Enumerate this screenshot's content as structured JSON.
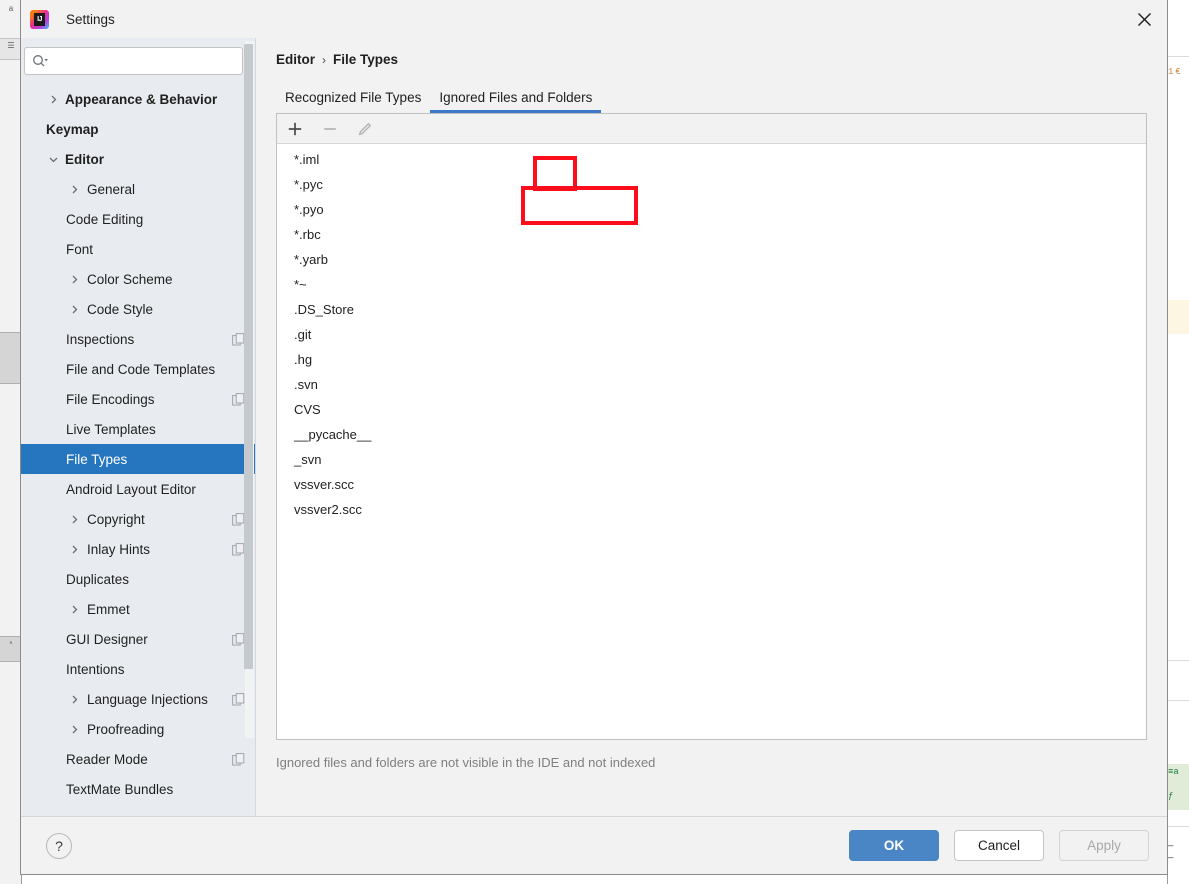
{
  "window": {
    "title": "Settings",
    "logo_icon": "intellij-idea-logo",
    "close_icon": "close-icon"
  },
  "search": {
    "value": "",
    "placeholder": "",
    "icon": "search-icon"
  },
  "sidebar": {
    "items": [
      {
        "label": "Appearance & Behavior",
        "level": 0,
        "arrow": "chevron-right-icon",
        "selected": false,
        "badge": false
      },
      {
        "label": "Keymap",
        "level": 0,
        "arrow": "",
        "selected": false,
        "badge": false
      },
      {
        "label": "Editor",
        "level": 0,
        "arrow": "chevron-down-icon",
        "selected": false,
        "badge": false
      },
      {
        "label": "General",
        "level": 1,
        "arrow": "chevron-right-icon",
        "selected": false,
        "badge": false
      },
      {
        "label": "Code Editing",
        "level": 1,
        "arrow": "",
        "selected": false,
        "badge": false
      },
      {
        "label": "Font",
        "level": 1,
        "arrow": "",
        "selected": false,
        "badge": false
      },
      {
        "label": "Color Scheme",
        "level": 1,
        "arrow": "chevron-right-icon",
        "selected": false,
        "badge": false
      },
      {
        "label": "Code Style",
        "level": 1,
        "arrow": "chevron-right-icon",
        "selected": false,
        "badge": false
      },
      {
        "label": "Inspections",
        "level": 1,
        "arrow": "",
        "selected": false,
        "badge": true
      },
      {
        "label": "File and Code Templates",
        "level": 1,
        "arrow": "",
        "selected": false,
        "badge": false
      },
      {
        "label": "File Encodings",
        "level": 1,
        "arrow": "",
        "selected": false,
        "badge": true
      },
      {
        "label": "Live Templates",
        "level": 1,
        "arrow": "",
        "selected": false,
        "badge": false
      },
      {
        "label": "File Types",
        "level": 1,
        "arrow": "",
        "selected": true,
        "badge": false
      },
      {
        "label": "Android Layout Editor",
        "level": 1,
        "arrow": "",
        "selected": false,
        "badge": false
      },
      {
        "label": "Copyright",
        "level": 1,
        "arrow": "chevron-right-icon",
        "selected": false,
        "badge": true
      },
      {
        "label": "Inlay Hints",
        "level": 1,
        "arrow": "chevron-right-icon",
        "selected": false,
        "badge": true
      },
      {
        "label": "Duplicates",
        "level": 1,
        "arrow": "",
        "selected": false,
        "badge": false
      },
      {
        "label": "Emmet",
        "level": 1,
        "arrow": "chevron-right-icon",
        "selected": false,
        "badge": false
      },
      {
        "label": "GUI Designer",
        "level": 1,
        "arrow": "",
        "selected": false,
        "badge": true
      },
      {
        "label": "Intentions",
        "level": 1,
        "arrow": "",
        "selected": false,
        "badge": false
      },
      {
        "label": "Language Injections",
        "level": 1,
        "arrow": "chevron-right-icon",
        "selected": false,
        "badge": true
      },
      {
        "label": "Proofreading",
        "level": 1,
        "arrow": "chevron-right-icon",
        "selected": false,
        "badge": false
      },
      {
        "label": "Reader Mode",
        "level": 1,
        "arrow": "",
        "selected": false,
        "badge": true
      },
      {
        "label": "TextMate Bundles",
        "level": 1,
        "arrow": "",
        "selected": false,
        "badge": false
      }
    ]
  },
  "content": {
    "breadcrumb": {
      "parent": "Editor",
      "separator": "›",
      "current": "File Types"
    },
    "tabs": [
      {
        "label": "Recognized File Types",
        "active": false
      },
      {
        "label": "Ignored Files and Folders",
        "active": true
      }
    ],
    "toolbar": [
      {
        "name": "add-button",
        "icon": "plus-icon",
        "label": "+",
        "enabled": true
      },
      {
        "name": "remove-button",
        "icon": "minus-icon",
        "label": "−",
        "enabled": false
      },
      {
        "name": "edit-button",
        "icon": "pencil-icon",
        "label": "✎",
        "enabled": false
      }
    ],
    "list": [
      "*.iml",
      "*.pyc",
      "*.pyo",
      "*.rbc",
      "*.yarb",
      "*~",
      ".DS_Store",
      ".git",
      ".hg",
      ".svn",
      "CVS",
      "__pycache__",
      "_svn",
      "vssver.scc",
      "vssver2.scc"
    ],
    "hint": "Ignored files and folders are not visible in the IDE and not indexed"
  },
  "footer": {
    "help_label": "?",
    "ok_label": "OK",
    "cancel_label": "Cancel",
    "apply_label": "Apply"
  },
  "colors": {
    "accent": "#2675bf",
    "tab_underline": "#3d78c8",
    "primary_button": "#4a86c5",
    "annotation": "#fc0d1b",
    "sidebar_bg": "#e8ecf0",
    "dialog_bg": "#f2f2f2"
  },
  "annotations": [
    {
      "name": "annotation-add-button",
      "target": "add-button"
    },
    {
      "name": "annotation-first-list-row",
      "target": "*.iml"
    }
  ],
  "background": {
    "left_strip": [
      "a",
      "",
      "",
      ""
    ],
    "right_strip": [
      "1 €",
      "",
      "= a",
      "ƒ"
    ]
  }
}
